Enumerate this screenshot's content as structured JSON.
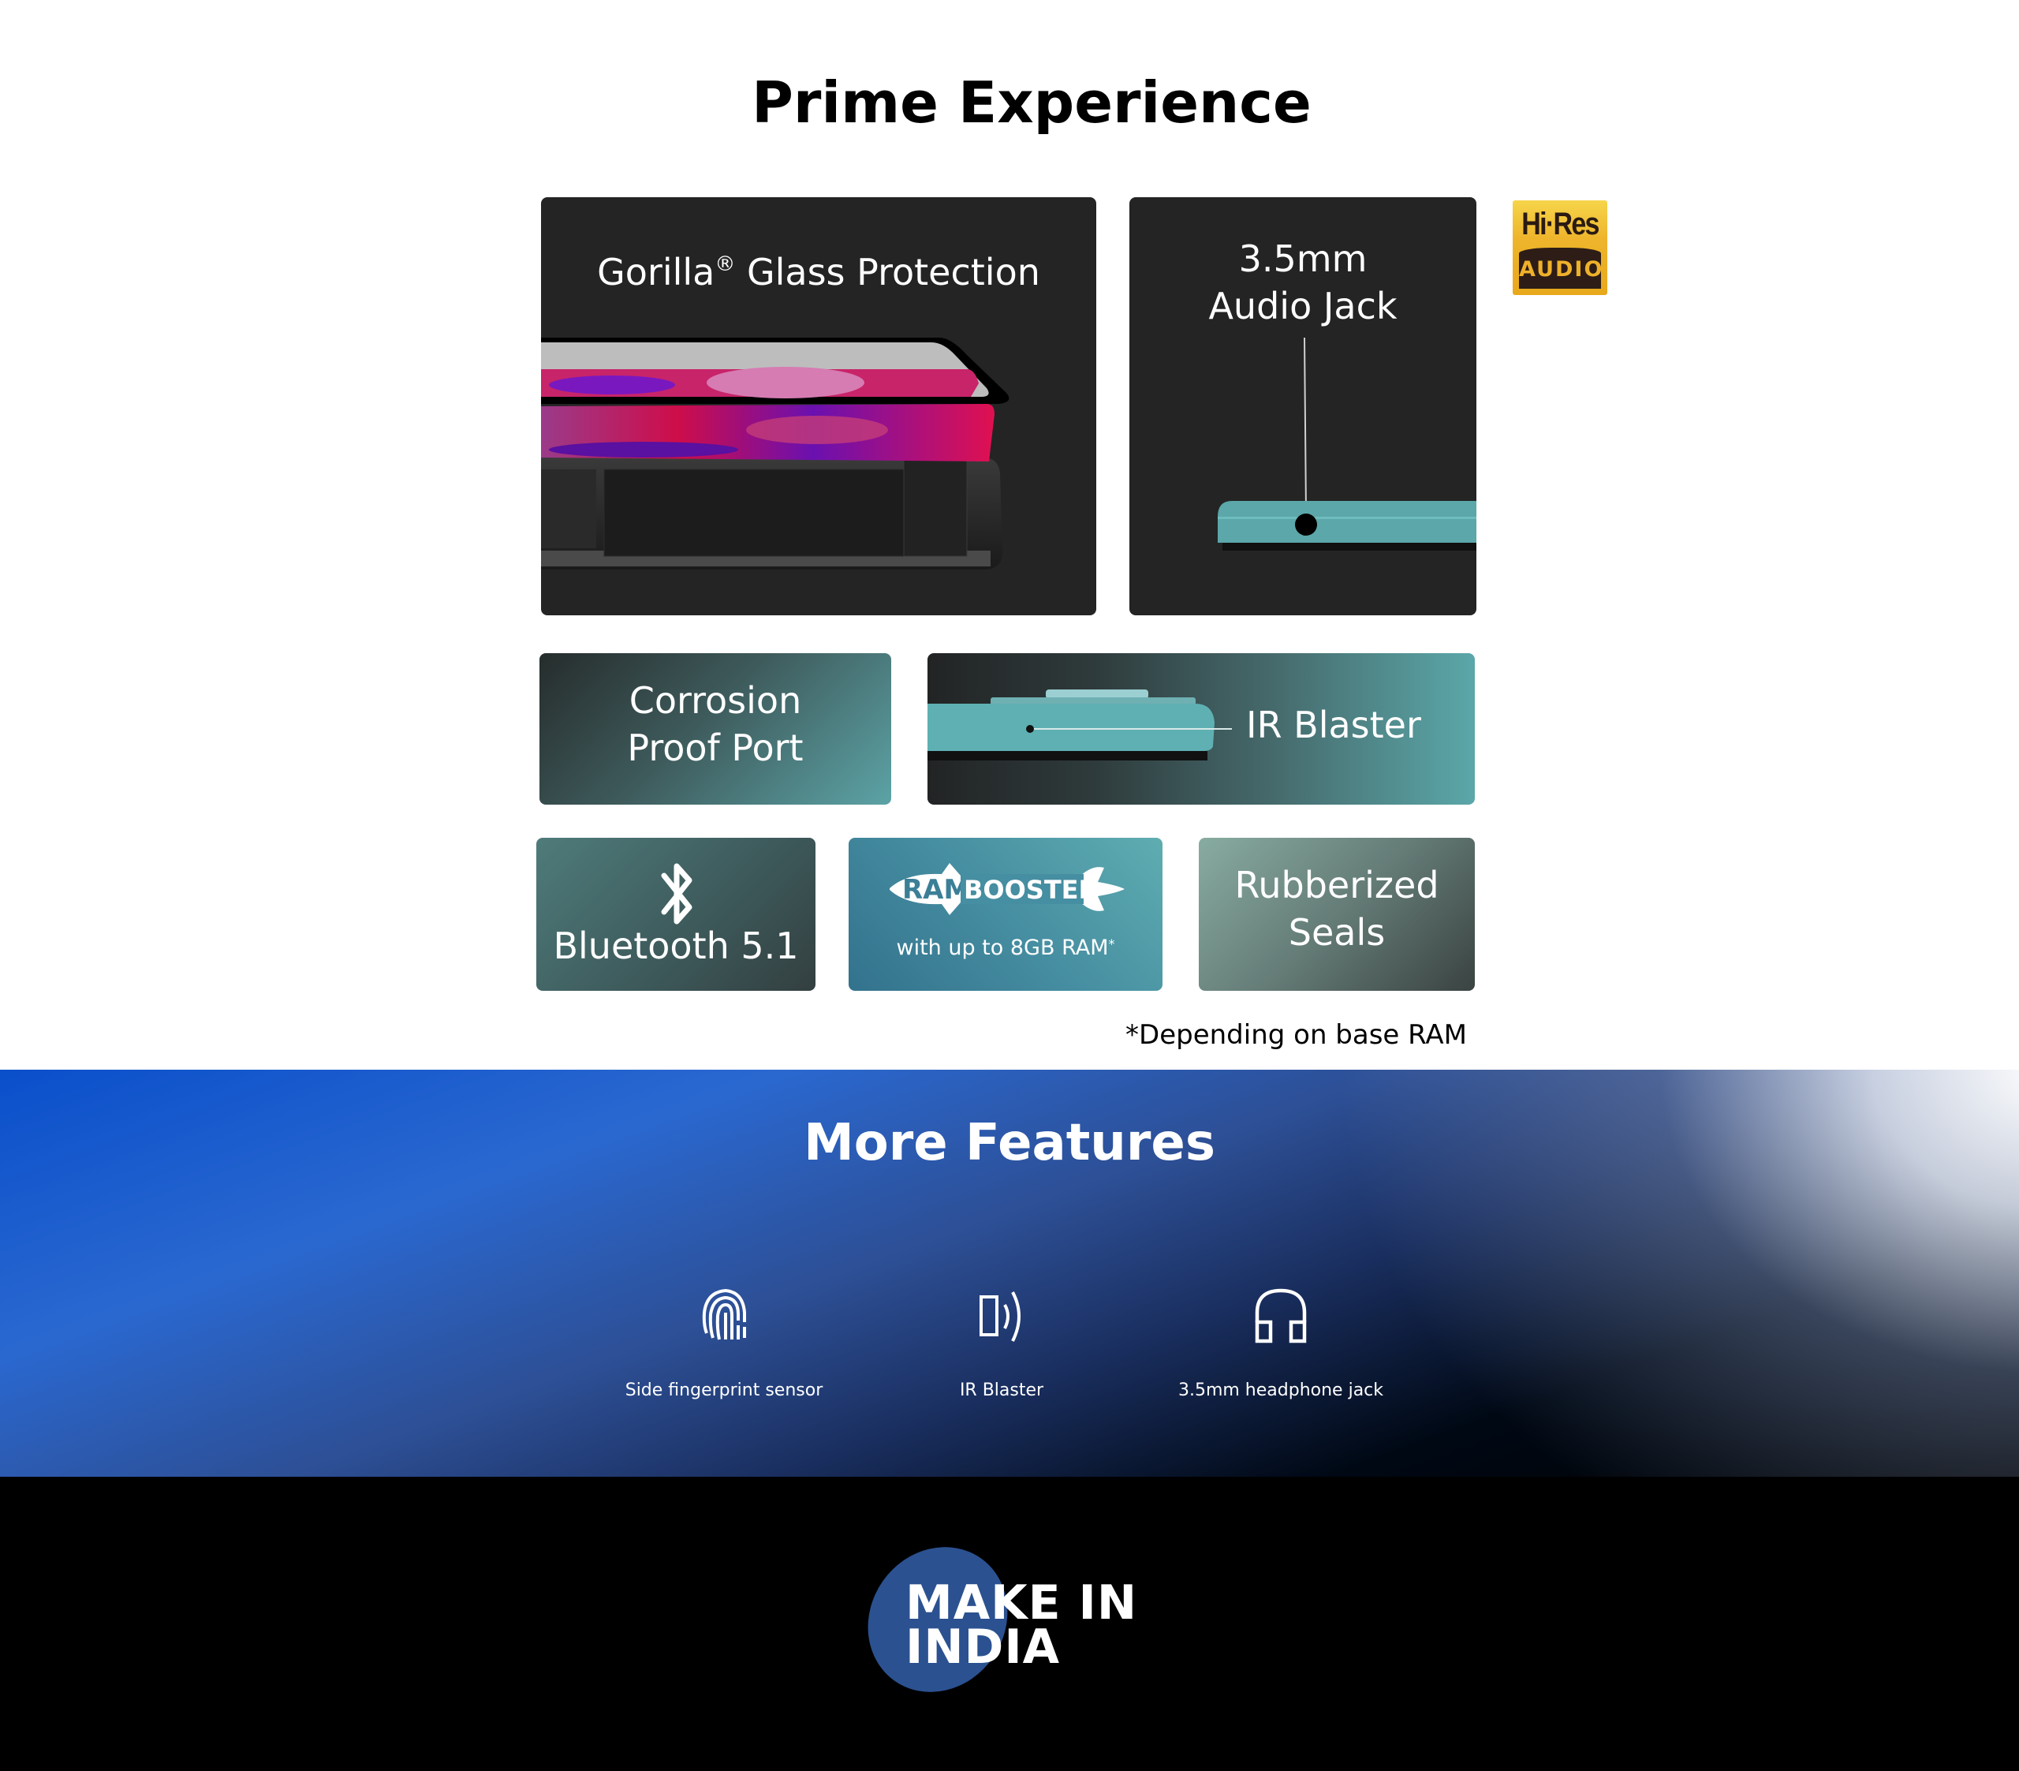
{
  "prime": {
    "title": "Prime Experience",
    "cards": {
      "gorilla": {
        "title_main": "Gorilla",
        "title_reg": "®",
        "title_rest": " Glass Protection"
      },
      "audio": {
        "line1": "3.5mm",
        "line2": "Audio Jack"
      },
      "hires": {
        "top": "Hi·Res",
        "bottom": "AUDIO"
      },
      "corrosion": {
        "line1": "Corrosion",
        "line2": "Proof Port"
      },
      "ir": {
        "title": "IR Blaster"
      },
      "bluetooth": {
        "title": "Bluetooth 5.1"
      },
      "ram": {
        "logo_ram": "RAM",
        "logo_booster": "BOOSTER",
        "subtitle": "with up to 8GB RAM",
        "asterisk": "*"
      },
      "rubber": {
        "line1": "Rubberized",
        "line2": "Seals"
      }
    },
    "footnote": "*Depending on base RAM"
  },
  "more_features": {
    "title": "More Features",
    "items": [
      {
        "icon": "fingerprint-icon",
        "label": "Side fingerprint sensor"
      },
      {
        "icon": "ir-blaster-icon",
        "label": "IR Blaster"
      },
      {
        "icon": "headphones-icon",
        "label": "3.5mm headphone jack"
      }
    ]
  },
  "make_in_india": {
    "line1": "MAKE IN",
    "line2": "INDIA"
  },
  "colors": {
    "card_dark": "#242424",
    "teal": "#5ca3a6",
    "hires_gold": "#eeb52c",
    "blue": "#0a4fcb",
    "mii_blue": "#2b5190"
  }
}
